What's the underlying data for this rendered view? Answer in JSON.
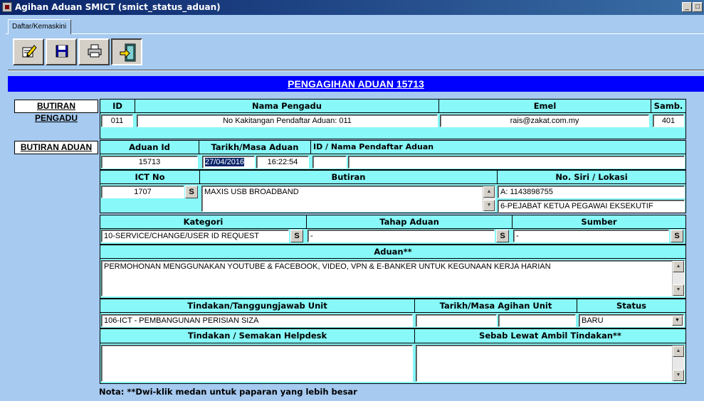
{
  "window": {
    "title": "Agihan Aduan SMICT (smict_status_aduan)",
    "min_glyph": "_",
    "max_glyph": "□"
  },
  "tabs": [
    {
      "label": "Daftar/Kemaskini"
    }
  ],
  "toolbar": {
    "buttons": [
      {
        "icon": "edit-icon"
      },
      {
        "icon": "save-icon"
      },
      {
        "icon": "print-icon"
      },
      {
        "icon": "exit-icon"
      }
    ]
  },
  "banner": {
    "title": "PENGAGIHAN ADUAN 15713"
  },
  "pengadu": {
    "section_label": "BUTIRAN PENGADU",
    "headers": {
      "id": "ID",
      "nama": "Nama Pengadu",
      "emel": "Emel",
      "samb": "Samb."
    },
    "values": {
      "id": "011",
      "nama": "No Kakitangan Pendaftar Aduan: 011",
      "emel": "rais@zakat.com.my",
      "samb": "401"
    }
  },
  "aduan": {
    "section_label": "BUTIRAN ADUAN",
    "headers": {
      "aduan_id": "Aduan Id",
      "tarikh": "Tarikh/Masa Aduan",
      "pendaftar": "ID / Nama Pendaftar Aduan"
    },
    "values": {
      "aduan_id": "15713",
      "tarikh": "27/04/2016",
      "masa": "16:22:54",
      "pendaftar_id": "",
      "pendaftar_nama": ""
    },
    "ict_header": "ICT No",
    "butiran_header": "Butiran",
    "siri_header": "No. Siri / Lokasi",
    "ict_no": "1707",
    "s_label": "S",
    "butiran": "MAXIS USB BROADBAND",
    "siri": "A: 1143898755",
    "lokasi": "6-PEJABAT KETUA PEGAWAI EKSEKUTIF",
    "kategori_header": "Kategori",
    "tahap_header": "Tahap Aduan",
    "sumber_header": "Sumber",
    "kategori": "10-SERVICE/CHANGE/USER ID REQUEST",
    "tahap": "-",
    "sumber": "-",
    "aduan_header": "Aduan**",
    "aduan_text": "PERMOHONAN MENGGUNAKAN YOUTUBE & FACEBOOK, VIDEO, VPN & E-BANKER UNTUK KEGUNAAN KERJA HARIAN",
    "tindakan_unit_header": "Tindakan/Tanggungjawab Unit",
    "tarikh_agihan_header": "Tarikh/Masa Agihan Unit",
    "status_header": "Status",
    "tindakan_unit": "106-ICT - PEMBANGUNAN PERISIAN SIZA",
    "tarikh_agihan": "",
    "masa_agihan": "",
    "status": "BARU",
    "semakan_header": "Tindakan / Semakan Helpdesk",
    "sebab_header": "Sebab Lewat Ambil Tindakan**",
    "semakan": "",
    "sebab": ""
  },
  "note": "Nota: **Dwi-klik medan untuk paparan yang lebih besar"
}
